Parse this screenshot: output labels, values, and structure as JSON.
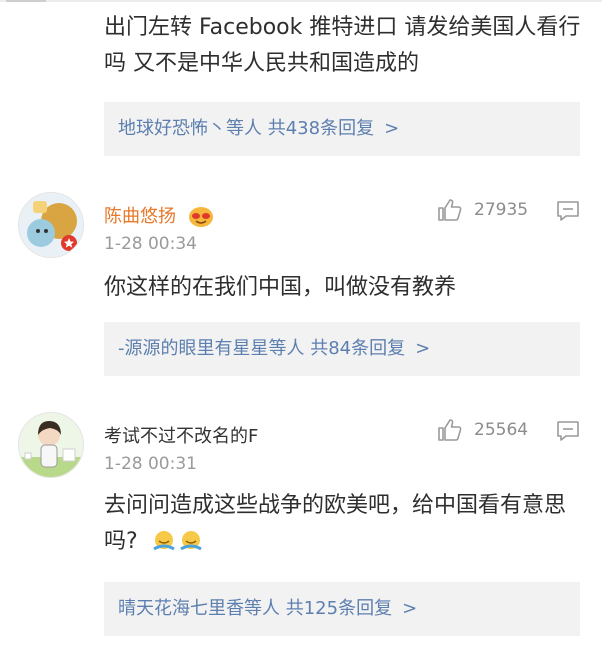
{
  "comment0": {
    "text": "出门左转 Facebook 推特进口 请发给美国人看行吗 又不是中华人民共和国造成的",
    "reply_summary": "地球好恐怖丶等人 共438条回复",
    "chevron": ">"
  },
  "comment1": {
    "username": "陈曲悠扬",
    "time": "1-28 00:34",
    "like_count": "27935",
    "text": "你这样的在我们中国，叫做没有教养",
    "reply_summary": "-源源的眼里有星星等人 共84条回复",
    "chevron": ">"
  },
  "comment2": {
    "username": "考试不过不改名的F",
    "time": "1-28 00:31",
    "like_count": "25564",
    "text": "去问问造成这些战争的欧美吧，给中国看有意思吗?",
    "reply_summary": "晴天花海七里香等人 共125条回复",
    "chevron": ">"
  },
  "colors": {
    "username_accent": "#e8782a",
    "reply_link": "#5d7fb0",
    "reply_bg": "#f2f2f2",
    "meta_gray": "#9a9a9a"
  },
  "icons": [
    "thumbs-up-icon",
    "comment-icon",
    "emoji-icon",
    "vip-badge-icon"
  ]
}
